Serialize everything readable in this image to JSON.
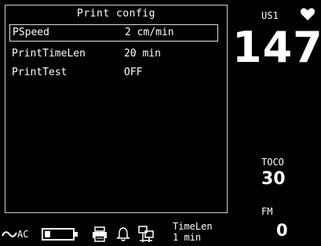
{
  "print_config": {
    "title": "Print config",
    "rows": [
      {
        "label": "PSpeed",
        "value": "2 cm/min",
        "selected": true
      },
      {
        "label": "PrintTimeLen",
        "value": "20 min",
        "selected": false
      },
      {
        "label": "PrintTest",
        "value": "OFF",
        "selected": false
      }
    ]
  },
  "vitals": {
    "fhr_label": "US1",
    "fhr_value": "147",
    "toco_label": "TOCO",
    "toco_value": "30",
    "fm_label": "FM",
    "fm_value": "0"
  },
  "status_bar": {
    "power_label": "AC",
    "battery_level": 0.2,
    "timelen_label": "TimeLen",
    "timelen_value": "1 min"
  },
  "icons": {
    "heart": "heart-icon",
    "ac": "ac-power-icon",
    "battery": "battery-icon",
    "printer": "printer-icon",
    "bell": "bell-icon",
    "network": "network-icon"
  },
  "colors": {
    "background": "#000000",
    "foreground": "#ffffff"
  }
}
